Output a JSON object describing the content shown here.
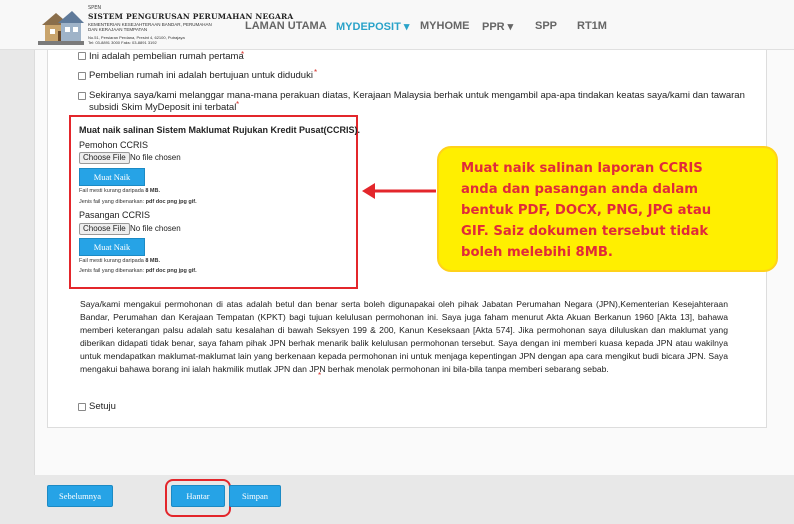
{
  "header": {
    "logo": {
      "small": "SPEN",
      "title": "SISTEM PENGURUSAN PERUMAHAN NEGARA",
      "sub1": "KEMENTERIAN KESEJAHTERAAN BANDAR, PERUMAHAN",
      "sub2": "DAN KERAJAAN TEMPATAN",
      "addr": "No.51, Persiaran Perdana, Presint 4, 62100, Putrajaya",
      "tel": "Tel: 03-8891 3000   Faks: 03-8891 3192"
    },
    "nav": [
      {
        "label": "LAMAN UTAMA"
      },
      {
        "label": "MYDEPOSIT ▾"
      },
      {
        "label": "MYHOME"
      },
      {
        "label": "PPR ▾"
      },
      {
        "label": "SPP"
      },
      {
        "label": "RT1M"
      }
    ]
  },
  "form": {
    "partial_top": "Ini adalah pembelian rumah pertama",
    "item1": "Pembelian rumah ini adalah bertujuan untuk diduduki",
    "item2_line1": "Sekiranya saya/kami melanggar mana-mana perakuan diatas, Kerajaan Malaysia berhak untuk mengambil apa-apa tindakan keatas saya/kami dan tawaran",
    "item2_line2": "subsidi Skim MyDeposit ini terbatal",
    "required": "*",
    "upload": {
      "heading": "Muat naik salinan Sistem Maklumat Rujukan Kredit Pusat(CCRIS).",
      "pemohon_label": "Pemohon CCRIS",
      "pasangan_label": "Pasangan CCRIS",
      "choose_file": "Choose File",
      "no_file": "No file chosen",
      "upload_button": "Muat Naik",
      "size_note": "Fail mesti kurang daripada",
      "size_value": "8 MB.",
      "type_note": "Jenis fail yang dibenarkan:",
      "type_value": "pdf doc png jpg gif."
    },
    "declaration": "Saya/kami mengakui permohonan di atas adalah betul dan benar serta boleh digunapakai oleh pihak Jabatan Perumahan Negara (JPN),Kementerian Kesejahteraan Bandar, Perumahan dan Kerajaan Tempatan (KPKT) bagi tujuan kelulusan permohonan ini. Saya juga faham menurut Akta Akuan Berkanun 1960 [Akta 13], bahawa memberi keterangan palsu adalah satu kesalahan di bawah Seksyen 199 & 200, Kanun Keseksaan [Akta 574]. Jika permohonan saya diluluskan dan maklumat yang diberikan didapati tidak benar, saya faham pihak JPN berhak menarik balik kelulusan permohonan tersebut. Saya dengan ini memberi kuasa kepada JPN atau wakilnya untuk mendapatkan maklumat-maklumat lain yang berkenaan kepada permohonan ini untuk menjaga kepentingan JPN dengan apa cara mengikut budi bicara JPN. Saya mengakui bahawa borang ini ialah hakmilik mutlak JPN dan JPN berhak menolak permohonan ini bila-bila tanpa memberi sebarang sebab.",
    "agree_label": "Setuju"
  },
  "callout": {
    "lines": [
      "Muat naik salinan laporan CCRIS",
      "anda dan pasangan anda dalam",
      "bentuk PDF, DOCX, PNG, JPG atau",
      "GIF. Saiz dokumen tersebut tidak",
      "boleh melebihi 8MB."
    ]
  },
  "buttons": {
    "previous": "Sebelumnya",
    "submit": "Hantar",
    "save": "Simpan"
  },
  "colors": {
    "accent": "#2aa3c9",
    "button": "#26a3e6",
    "highlight_red": "#e3262b",
    "callout_bg": "#ffef00",
    "callout_text": "#e02a3a"
  }
}
